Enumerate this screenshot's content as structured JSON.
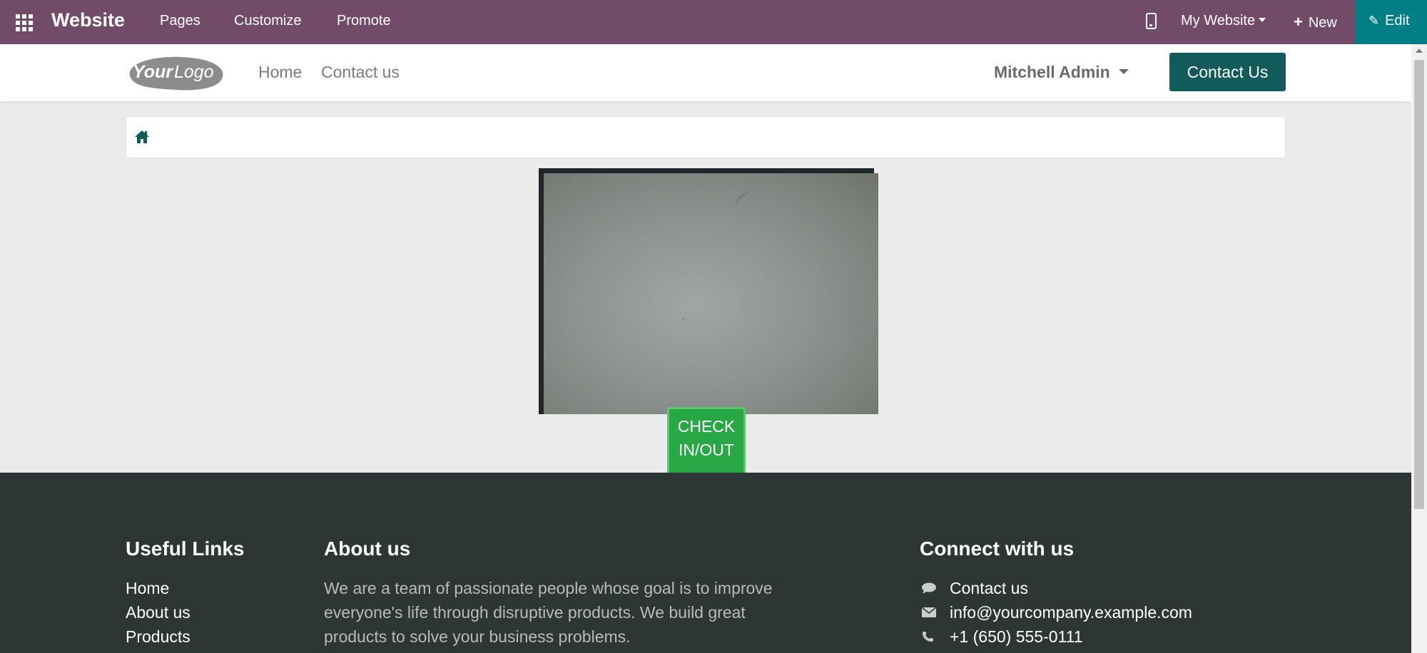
{
  "admin_bar": {
    "brand": "Website",
    "menu": [
      "Pages",
      "Customize",
      "Promote"
    ],
    "site_selector": "My Website",
    "new_label": "New",
    "edit_label": "Edit",
    "colors": {
      "bar": "#714b67",
      "edit": "#017e84"
    }
  },
  "header": {
    "logo_text": "YourLogo",
    "nav": [
      "Home",
      "Contact us"
    ],
    "user": "Mitchell Admin",
    "cta": "Contact Us",
    "cta_color": "#135b5b"
  },
  "breadcrumb": {
    "icon": "home-icon"
  },
  "camera": {
    "button_label": "CHECK IN/OUT",
    "button_color": "#28a745"
  },
  "footer": {
    "useful_links": {
      "title": "Useful Links",
      "items": [
        "Home",
        "About us",
        "Products"
      ]
    },
    "about": {
      "title": "About us",
      "text": "We are a team of passionate people whose goal is to improve everyone's life through disruptive products. We build great products to solve your business problems."
    },
    "connect": {
      "title": "Connect with us",
      "items": [
        {
          "icon": "comment-icon",
          "label": "Contact us"
        },
        {
          "icon": "envelope-icon",
          "label": "info@yourcompany.example.com"
        },
        {
          "icon": "phone-icon",
          "label": "+1 (650) 555-0111"
        }
      ]
    },
    "bg": "#2d3535"
  }
}
